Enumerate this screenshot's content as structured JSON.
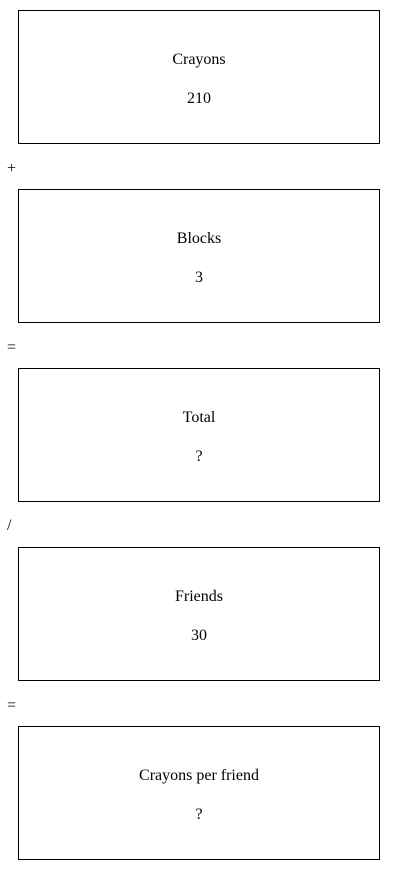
{
  "boxes": [
    {
      "label": "Crayons",
      "value": "210"
    },
    {
      "label": "Blocks",
      "value": "3"
    },
    {
      "label": "Total",
      "value": "?"
    },
    {
      "label": "Friends",
      "value": "30"
    },
    {
      "label": "Crayons per friend",
      "value": "?"
    }
  ],
  "operators": [
    "+",
    "=",
    "/",
    "="
  ]
}
